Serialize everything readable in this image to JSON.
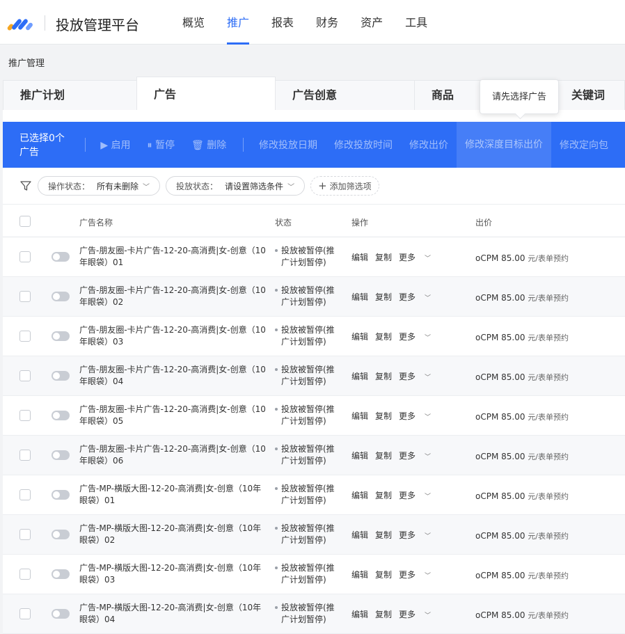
{
  "app": {
    "title": "投放管理平台"
  },
  "topnav": [
    "概览",
    "推广",
    "报表",
    "财务",
    "资产",
    "工具"
  ],
  "breadcrumb": "推广管理",
  "tabs": [
    "推广计划",
    "广告",
    "广告创意",
    "商品",
    "关键词"
  ],
  "tooltip": "请先选择广告",
  "actionbar": {
    "selected": "已选择0个广告",
    "enable": "▶ 启用",
    "pause": "⏸ 暂停",
    "delete": "🗑 删除",
    "edit_dates": "修改投放日期",
    "edit_time": "修改投放时间",
    "edit_bid": "修改出价",
    "edit_deep_bid": "修改深度目标出价",
    "edit_targeting": "修改定向包"
  },
  "filters": {
    "op_status_key": "操作状态：",
    "op_status_val": "所有未删除",
    "delivery_status_key": "投放状态：",
    "delivery_status_val": "请设置筛选条件",
    "add": "添加筛选项"
  },
  "columns": {
    "name": "广告名称",
    "status": "状态",
    "ops": "操作",
    "bid": "出价"
  },
  "row_common": {
    "status": "投放被暂停(推广计划暂停)",
    "edit": "编辑",
    "copy": "复制",
    "more": "更多",
    "bid_value": "oCPM  85.00",
    "bid_unit": "元/表单预约"
  },
  "rows": [
    {
      "name": "广告-朋友圈-卡片广告-12-20-高消费|女-创意（10年眼袋）01"
    },
    {
      "name": "广告-朋友圈-卡片广告-12-20-高消费|女-创意（10年眼袋）02"
    },
    {
      "name": "广告-朋友圈-卡片广告-12-20-高消费|女-创意（10年眼袋）03"
    },
    {
      "name": "广告-朋友圈-卡片广告-12-20-高消费|女-创意（10年眼袋）04"
    },
    {
      "name": "广告-朋友圈-卡片广告-12-20-高消费|女-创意（10年眼袋）05"
    },
    {
      "name": "广告-朋友圈-卡片广告-12-20-高消费|女-创意（10年眼袋）06"
    },
    {
      "name": "广告-MP-横版大图-12-20-高消费|女-创意（10年眼袋）01"
    },
    {
      "name": "广告-MP-横版大图-12-20-高消费|女-创意（10年眼袋）02"
    },
    {
      "name": "广告-MP-横版大图-12-20-高消费|女-创意（10年眼袋）03"
    },
    {
      "name": "广告-MP-横版大图-12-20-高消费|女-创意（10年眼袋）04"
    }
  ]
}
